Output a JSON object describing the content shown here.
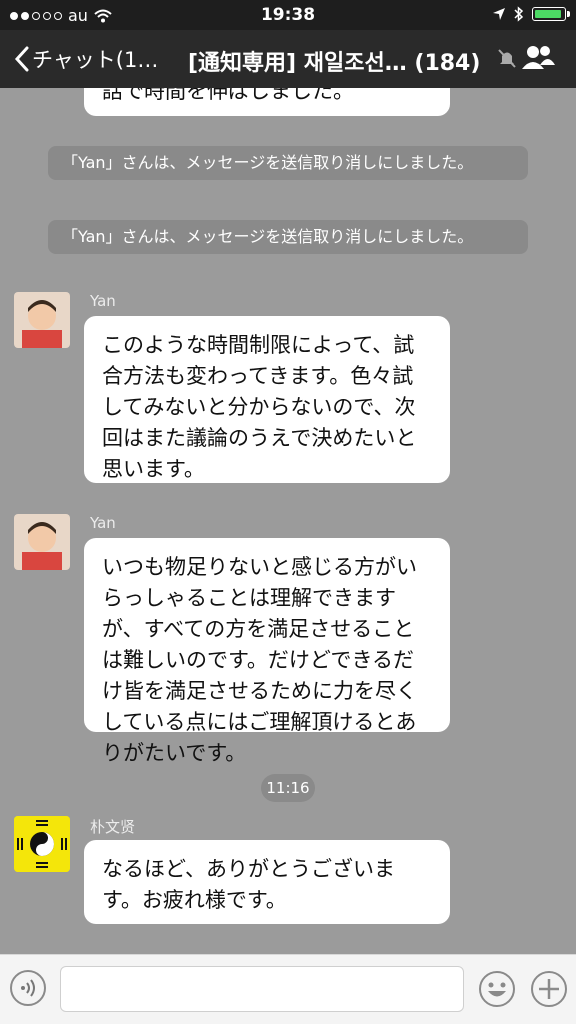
{
  "status_bar": {
    "carrier": "au",
    "time": "19:38",
    "battery_color": "#4cd964"
  },
  "nav": {
    "back_label": "チャット(1…",
    "title": "[通知専用] 재일조선… (184)",
    "icons": [
      "chevron-left-icon",
      "bell-muted-icon",
      "members-icon"
    ]
  },
  "messages": {
    "partial_text": "話で時間を伸ばしました。",
    "system_1": "「Yan」さんは、メッセージを送信取り消しにしました。",
    "system_2": "「Yan」さんは、メッセージを送信取り消しにしました。",
    "msg_1": {
      "sender": "Yan",
      "text": "このような時間制限によって、試合方法も変わってきます。色々試してみないと分からないので、次回はまた議論のうえで決めたいと思います。"
    },
    "msg_2": {
      "sender": "Yan",
      "text": "いつも物足りないと感じる方がいらっしゃることは理解できますが、すべての方を満足させることは難しいのです。だけどできるだけ皆を満足させるために力を尽くしている点にはご理解頂けるとありがたいです。"
    },
    "time_divider": "11:16",
    "msg_3": {
      "sender": "朴文贤",
      "text": "なるほど、ありがとうございます。お疲れ様です。"
    }
  },
  "input_bar": {
    "placeholder": "",
    "icons": [
      "voice-icon",
      "emoji-icon",
      "plus-icon"
    ]
  },
  "colors": {
    "chat_bg": "#9b9b9b",
    "nav_bg": "#2a2a2a",
    "system_bubble": "#8a8a8a"
  }
}
